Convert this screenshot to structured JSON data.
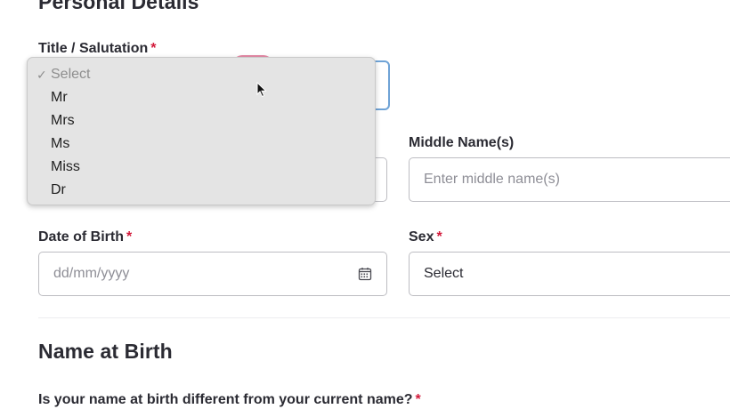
{
  "sections": {
    "personal_details_title": "Personal Details",
    "name_at_birth_title": "Name at Birth"
  },
  "fields": {
    "title": {
      "label": "Title / Salutation",
      "required_mark": "*"
    },
    "middle_names": {
      "label": "Middle Name(s)",
      "placeholder": "Enter middle name(s)"
    },
    "dob": {
      "label": "Date of Birth",
      "required_mark": "*",
      "placeholder": "dd/mm/yyyy",
      "icon": "calendar-icon"
    },
    "sex": {
      "label": "Sex",
      "required_mark": "*",
      "value": "Select"
    }
  },
  "title_dropdown": {
    "selected": "Select",
    "options": [
      "Select",
      "Mr",
      "Mrs",
      "Ms",
      "Miss",
      "Dr"
    ],
    "check_glyph": "✓"
  },
  "name_at_birth": {
    "question": "Is your name at birth different from your current name?",
    "required_mark": "*"
  },
  "colors": {
    "required": "#d2193a",
    "focus_ring": "#6fa3d6",
    "text": "#2b2b33",
    "placeholder": "#8e8e96"
  }
}
